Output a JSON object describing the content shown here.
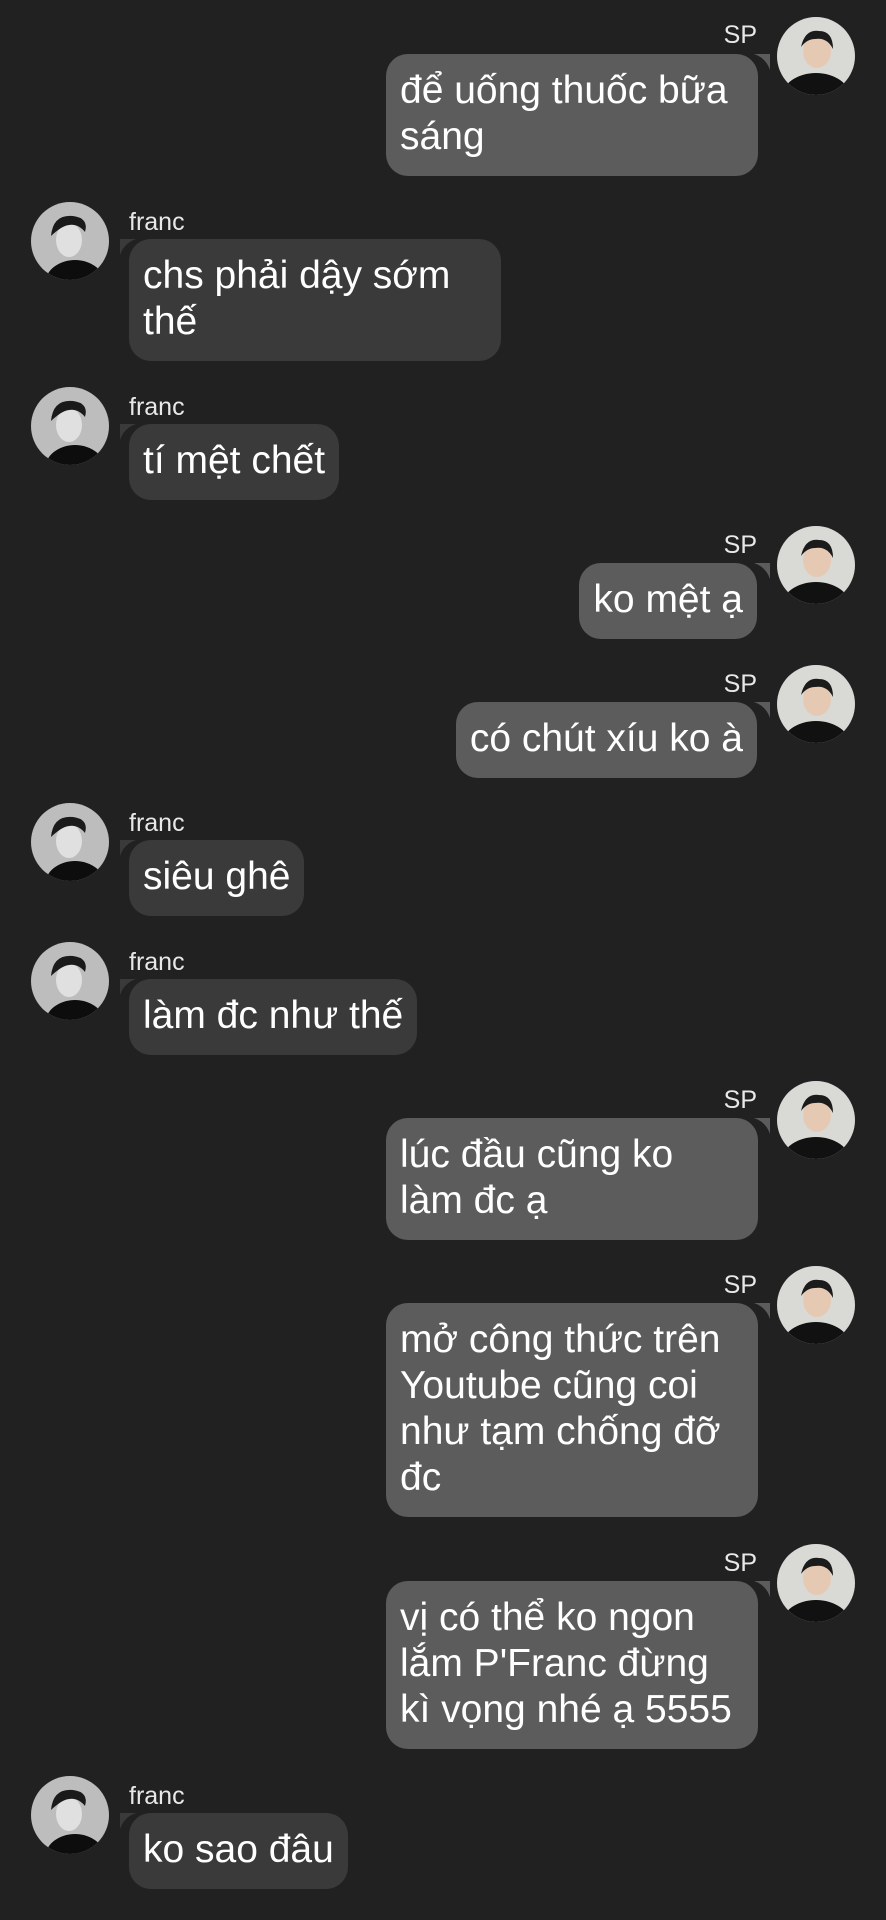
{
  "colors": {
    "background": "#212122",
    "outgoing_bubble": "#5c5c5c",
    "incoming_bubble": "#3a3a3b",
    "text": "#ffffff"
  },
  "participants": {
    "self": {
      "name": "SP",
      "avatar_icon": "avatar-photo-sp"
    },
    "other": {
      "name": "franc",
      "avatar_icon": "avatar-photo-franc"
    }
  },
  "messages": [
    {
      "sender": "SP",
      "side": "right",
      "text": "để uống thuốc bữa\nsáng"
    },
    {
      "sender": "franc",
      "side": "left",
      "text": "chs phải dậy sớm\nthế"
    },
    {
      "sender": "franc",
      "side": "left",
      "text": "tí mệt chết"
    },
    {
      "sender": "SP",
      "side": "right",
      "text": "ko mệt ạ"
    },
    {
      "sender": "SP",
      "side": "right",
      "text": "có chút xíu ko à"
    },
    {
      "sender": "franc",
      "side": "left",
      "text": "siêu ghê"
    },
    {
      "sender": "franc",
      "side": "left",
      "text": "làm đc như thế"
    },
    {
      "sender": "SP",
      "side": "right",
      "text": "lúc đầu cũng ko\nlàm đc ạ"
    },
    {
      "sender": "SP",
      "side": "right",
      "text": "mở công thức trên\nYoutube cũng coi\nnhư tạm chống đỡ\nđc"
    },
    {
      "sender": "SP",
      "side": "right",
      "text": "vị có thể ko ngon\nlắm P'Franc đừng\nkì vọng nhé ạ 5555"
    },
    {
      "sender": "franc",
      "side": "left",
      "text": "ko sao đâu"
    }
  ]
}
